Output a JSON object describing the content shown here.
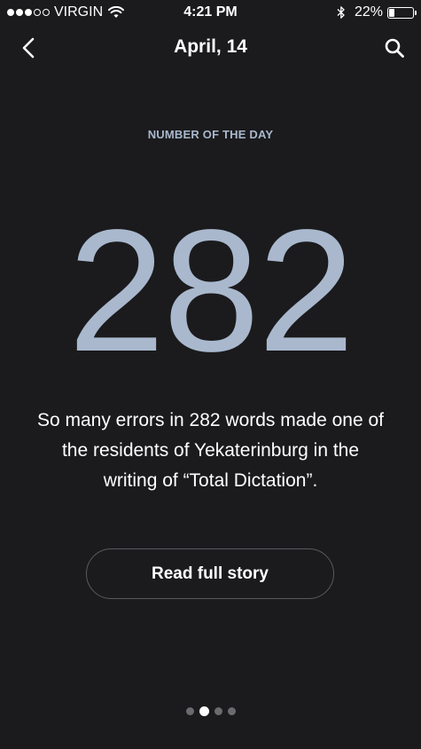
{
  "status_bar": {
    "carrier": "VIRGIN",
    "time": "4:21 PM",
    "battery": "22%",
    "battery_level": 0.22,
    "signal_bars_filled": 3,
    "signal_bars_total": 5
  },
  "nav": {
    "title": "April, 14",
    "back_icon": "chevron-left-icon",
    "search_icon": "search-icon"
  },
  "content": {
    "section_label": "NUMBER OF THE DAY",
    "number": "282",
    "description": "So many errors in 282 words made one of the residents of Yekaterinburg in the writing of “Total Dictation”.",
    "button_label": "Read full story"
  },
  "pager": {
    "total": 4,
    "active_index": 1
  },
  "colors": {
    "background": "#1b1b1d",
    "accent": "#a9b8cd",
    "text": "#ffffff"
  }
}
